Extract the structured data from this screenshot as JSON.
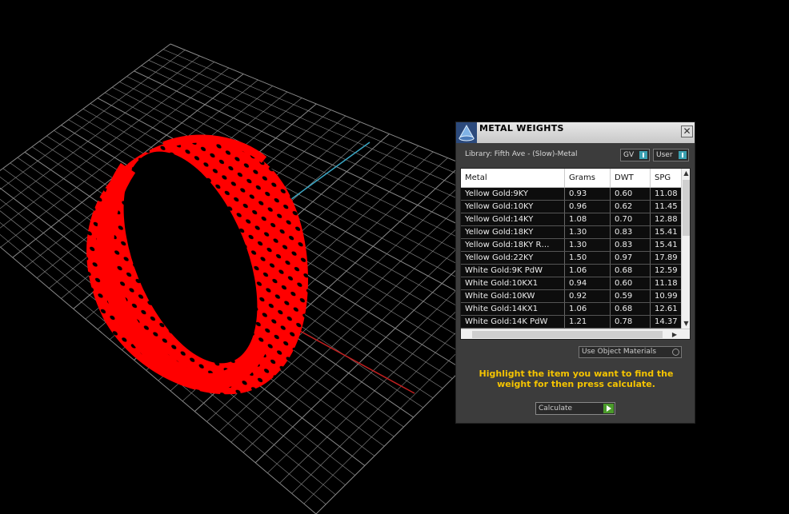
{
  "dialog": {
    "title": "METAL WEIGHTS",
    "close_glyph": "✕",
    "library": "Library: Fifth Ave - (Slow)-Metal",
    "unit_gv": "GV",
    "unit_user": "User",
    "columns": [
      "Metal",
      "Grams",
      "DWT",
      "SPG"
    ],
    "rows": [
      [
        "Yellow Gold:9KY",
        "0.93",
        "0.60",
        "11.08"
      ],
      [
        "Yellow Gold:10KY",
        "0.96",
        "0.62",
        "11.45"
      ],
      [
        "Yellow Gold:14KY",
        "1.08",
        "0.70",
        "12.88"
      ],
      [
        "Yellow Gold:18KY",
        "1.30",
        "0.83",
        "15.41"
      ],
      [
        "Yellow Gold:18KY R…",
        "1.30",
        "0.83",
        "15.41"
      ],
      [
        "Yellow Gold:22KY",
        "1.50",
        "0.97",
        "17.89"
      ],
      [
        "White Gold:9K PdW",
        "1.06",
        "0.68",
        "12.59"
      ],
      [
        "White Gold:10KX1",
        "0.94",
        "0.60",
        "11.18"
      ],
      [
        "White Gold:10KW",
        "0.92",
        "0.59",
        "10.99"
      ],
      [
        "White Gold:14KX1",
        "1.06",
        "0.68",
        "12.61"
      ],
      [
        "White Gold:14K PdW",
        "1.21",
        "0.78",
        "14.37"
      ]
    ],
    "use_object_materials": "Use Object Materials",
    "hint": "Highlight the item you want to find the weight for then press calculate.",
    "calculate": "Calculate"
  },
  "colors": {
    "ring": "#ff0000",
    "grid": "#8a8a8a",
    "axis_x": "#c02020",
    "axis_y": "#3aa6c4",
    "hint_text": "#f5c400"
  },
  "icons": {
    "app": "metal-weights-app-icon",
    "close": "close-icon",
    "scroll_up": "scroll-up-icon",
    "scroll_down": "scroll-down-icon",
    "scroll_right": "scroll-right-icon",
    "calculate": "go-arrow-icon"
  }
}
